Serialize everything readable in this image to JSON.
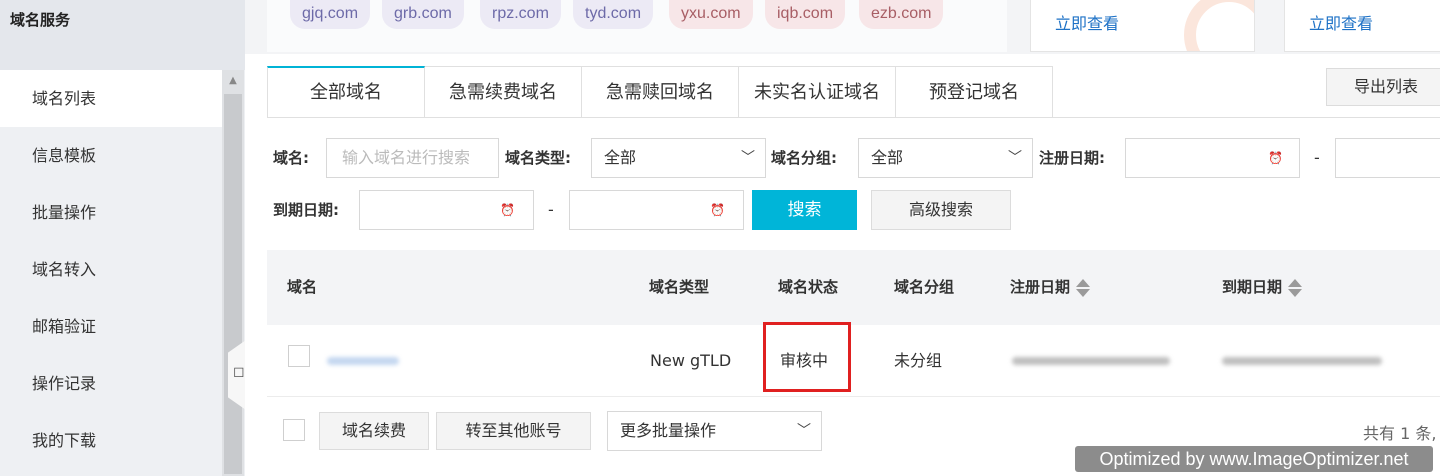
{
  "sidebar": {
    "title": "域名服务",
    "items": [
      {
        "label": "域名列表"
      },
      {
        "label": "信息模板"
      },
      {
        "label": "批量操作"
      },
      {
        "label": "域名转入"
      },
      {
        "label": "邮箱验证"
      },
      {
        "label": "操作记录"
      },
      {
        "label": "我的下载"
      }
    ]
  },
  "tlds": [
    "gjq.com",
    "grb.com",
    "rpz.com",
    "tyd.com",
    "yxu.com",
    "iqb.com",
    "ezb.com"
  ],
  "promos": [
    {
      "link": "立即查看"
    },
    {
      "link": "立即查看"
    }
  ],
  "tabs": [
    "全部域名",
    "急需续费域名",
    "急需赎回域名",
    "未实名认证域名",
    "预登记域名"
  ],
  "export_label": "导出列表",
  "filters": {
    "domain_label": "域名:",
    "domain_placeholder": "输入域名进行搜索",
    "type_label": "域名类型:",
    "type_value": "全部",
    "group_label": "域名分组:",
    "group_value": "全部",
    "reg_date_label": "注册日期:",
    "exp_date_label": "到期日期:",
    "dash": "-",
    "search_label": "搜索",
    "advanced_label": "高级搜索"
  },
  "table": {
    "headers": [
      "域名",
      "域名类型",
      "域名状态",
      "域名分组",
      "注册日期",
      "到期日期"
    ],
    "rows": [
      {
        "type": "New gTLD",
        "status": "审核中",
        "group": "未分组"
      }
    ]
  },
  "bottom": {
    "renew_label": "域名续费",
    "transfer_label": "转至其他账号",
    "batch_label": "更多批量操作",
    "total_text": "共有 1 条,"
  },
  "watermark": "Optimized by www.ImageOptimizer.net",
  "colors": {
    "accent": "#00b5d8",
    "highlight": "#e02020",
    "link": "#1d71c6"
  }
}
